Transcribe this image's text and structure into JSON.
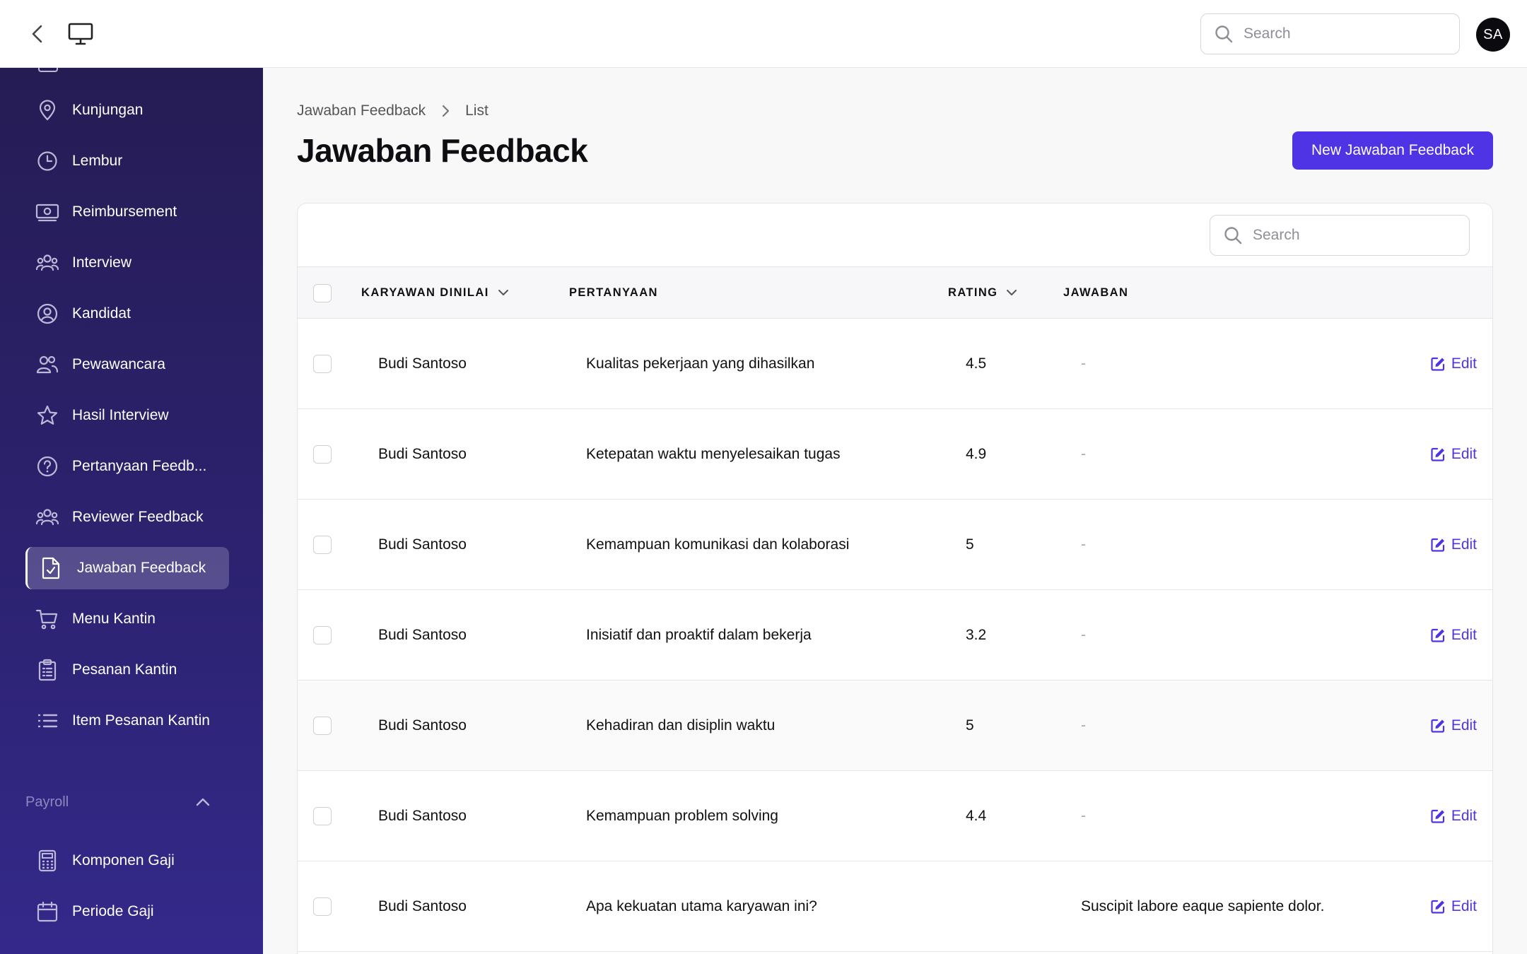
{
  "topbar": {
    "search_placeholder": "Search",
    "avatar_initials": "SA"
  },
  "sidebar": {
    "items": [
      {
        "label": "Kunjungan",
        "icon": "map-pin-icon"
      },
      {
        "label": "Lembur",
        "icon": "clock-icon"
      },
      {
        "label": "Reimbursement",
        "icon": "banknote-icon"
      },
      {
        "label": "Interview",
        "icon": "user-group-icon"
      },
      {
        "label": "Kandidat",
        "icon": "user-circle-icon"
      },
      {
        "label": "Pewawancara",
        "icon": "users-icon"
      },
      {
        "label": "Hasil Interview",
        "icon": "star-icon"
      },
      {
        "label": "Pertanyaan Feedb...",
        "icon": "question-circle-icon"
      },
      {
        "label": "Reviewer Feedback",
        "icon": "user-group-icon"
      },
      {
        "label": "Jawaban Feedback",
        "icon": "document-check-icon",
        "active": true
      },
      {
        "label": "Menu Kantin",
        "icon": "shopping-cart-icon"
      },
      {
        "label": "Pesanan Kantin",
        "icon": "clipboard-list-icon"
      },
      {
        "label": "Item Pesanan Kantin",
        "icon": "list-icon"
      }
    ],
    "group_payroll": "Payroll",
    "payroll_items": [
      {
        "label": "Komponen Gaji",
        "icon": "calculator-icon"
      },
      {
        "label": "Periode Gaji",
        "icon": "calendar-icon"
      }
    ]
  },
  "breadcrumb": {
    "parent": "Jawaban Feedback",
    "current": "List"
  },
  "page": {
    "title": "Jawaban Feedback",
    "new_button": "New Jawaban Feedback"
  },
  "table": {
    "search_placeholder": "Search",
    "columns": {
      "karyawan": "KARYAWAN DINILAI",
      "pertanyaan": "PERTANYAAN",
      "rating": "RATING",
      "jawaban": "JAWABAN"
    },
    "edit_label": "Edit",
    "rows": [
      {
        "karyawan": "Budi Santoso",
        "pertanyaan": "Kualitas pekerjaan yang dihasilkan",
        "rating": "4.5",
        "jawaban": "-"
      },
      {
        "karyawan": "Budi Santoso",
        "pertanyaan": "Ketepatan waktu menyelesaikan tugas",
        "rating": "4.9",
        "jawaban": "-"
      },
      {
        "karyawan": "Budi Santoso",
        "pertanyaan": "Kemampuan komunikasi dan kolaborasi",
        "rating": "5",
        "jawaban": "-"
      },
      {
        "karyawan": "Budi Santoso",
        "pertanyaan": "Inisiatif dan proaktif dalam bekerja",
        "rating": "3.2",
        "jawaban": "-"
      },
      {
        "karyawan": "Budi Santoso",
        "pertanyaan": "Kehadiran dan disiplin waktu",
        "rating": "5",
        "jawaban": "-"
      },
      {
        "karyawan": "Budi Santoso",
        "pertanyaan": "Kemampuan problem solving",
        "rating": "4.4",
        "jawaban": "-"
      },
      {
        "karyawan": "Budi Santoso",
        "pertanyaan": "Apa kekuatan utama karyawan ini?",
        "rating": "",
        "jawaban": "Suscipit labore eaque sapiente dolor."
      }
    ]
  },
  "colors": {
    "accent": "#4f34e6",
    "sidebar_top": "#251c54",
    "sidebar_bottom": "#34298a"
  }
}
